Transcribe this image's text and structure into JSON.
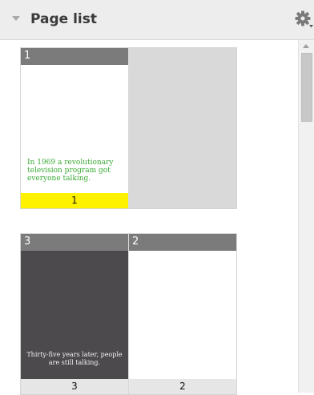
{
  "header": {
    "title": "Page list",
    "collapse_icon": "triangle-down-icon",
    "settings_icon": "gear-icon"
  },
  "spreads": [
    {
      "pages": [
        {
          "number": "1",
          "label": "1",
          "label_color": "#fff200",
          "text": "In 1969 a revolutionary television program got everyone talking.",
          "text_color": "#3aaa35",
          "background": "#ffffff"
        }
      ]
    },
    {
      "pages": [
        {
          "number": "3",
          "label": "3",
          "text": "Thirty-five years later, people are still talking.",
          "text_color": "#f2f2f2",
          "background": "#4c4a4c"
        },
        {
          "number": "2",
          "label": "2",
          "background": "#ffffff"
        }
      ]
    }
  ],
  "scrollbar": {
    "up_icon": "arrow-up-icon"
  }
}
